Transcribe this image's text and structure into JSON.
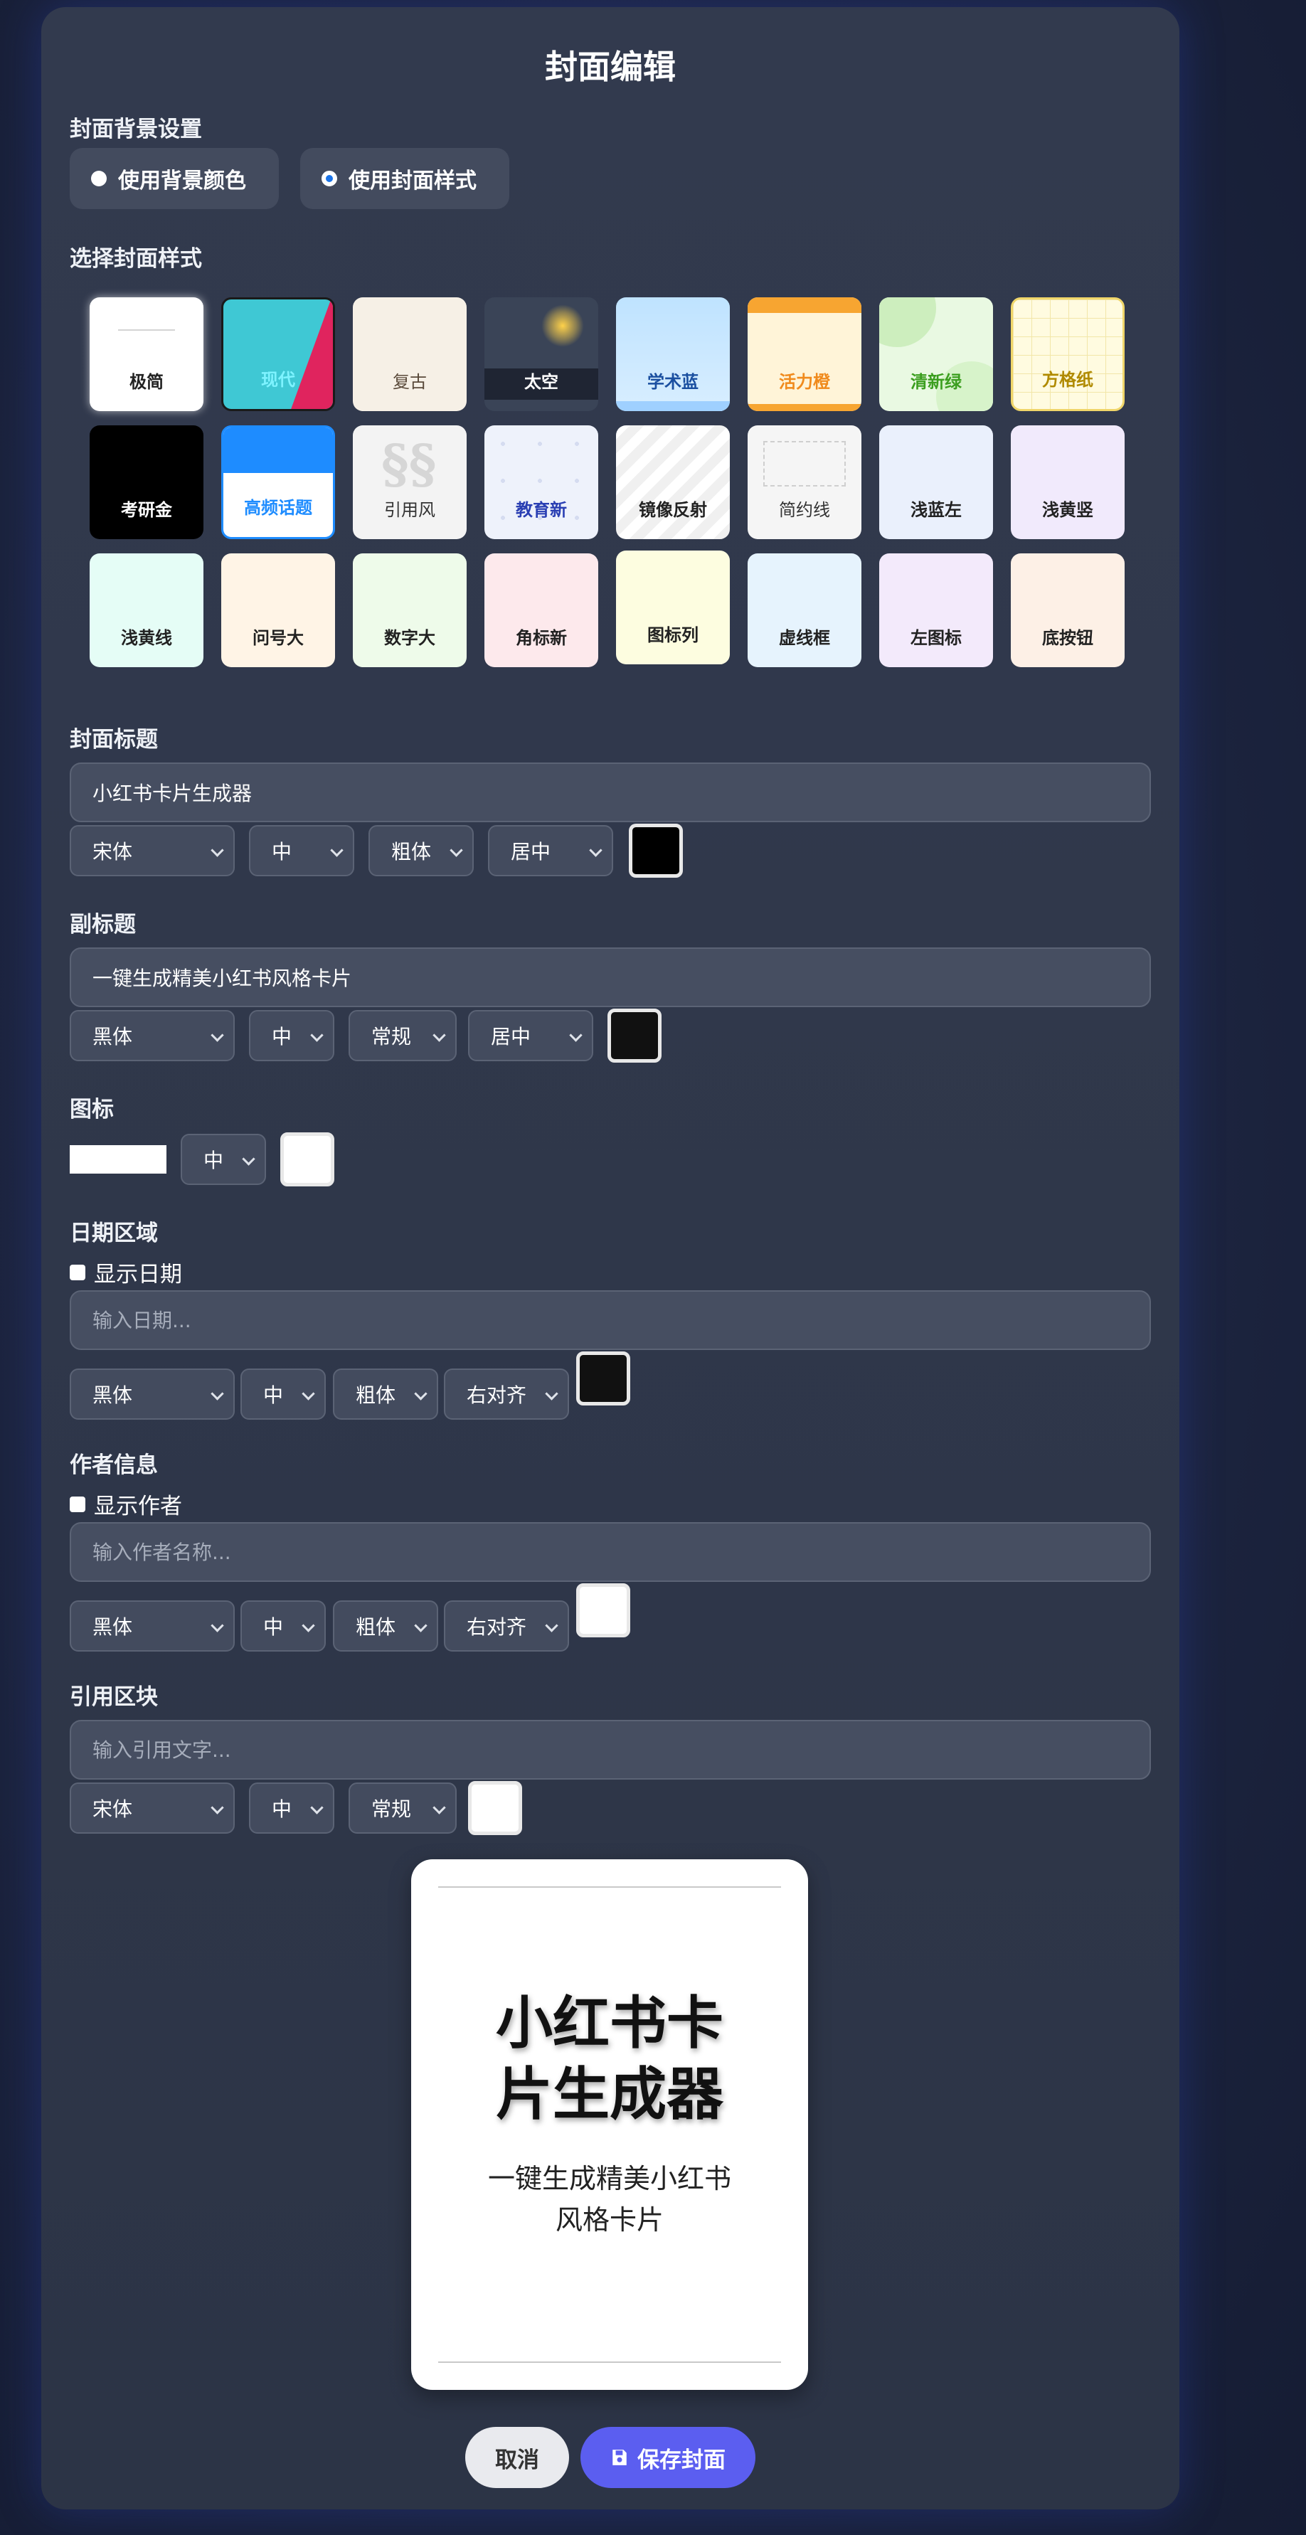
{
  "page": {
    "title": "封面编辑"
  },
  "background": {
    "label": "封面背景设置",
    "options": [
      {
        "label": "使用背景颜色",
        "selected": false
      },
      {
        "label": "使用封面样式",
        "selected": true
      }
    ]
  },
  "styles": {
    "label": "选择封面样式",
    "items": [
      "极简",
      "现代",
      "复古",
      "太空",
      "学术蓝",
      "活力橙",
      "清新绿",
      "方格纸",
      "考研金",
      "高频话题",
      "引用风",
      "教育新",
      "镜像反射",
      "简约线",
      "浅蓝左",
      "浅黄竖",
      "浅黄线",
      "问号大",
      "数字大",
      "角标新",
      "图标列",
      "虚线框",
      "左图标",
      "底按钮"
    ]
  },
  "cover_title": {
    "label": "封面标题",
    "value": "小红书卡片生成器",
    "font": "宋体",
    "size": "中",
    "weight": "粗体",
    "align": "居中",
    "color": "#000000"
  },
  "subtitle": {
    "label": "副标题",
    "value": "一键生成精美小红书风格卡片",
    "font": "黑体",
    "size": "中",
    "weight": "常规",
    "align": "居中",
    "color": "#111111"
  },
  "icon": {
    "label": "图标",
    "size": "中",
    "color": "#ffffff"
  },
  "date": {
    "label": "日期区域",
    "show_label": "显示日期",
    "placeholder": "输入日期...",
    "font": "黑体",
    "size": "中",
    "weight": "粗体",
    "align": "右对齐",
    "color": "#111111"
  },
  "author": {
    "label": "作者信息",
    "show_label": "显示作者",
    "placeholder": "输入作者名称...",
    "font": "黑体",
    "size": "中",
    "weight": "粗体",
    "align": "右对齐",
    "color": "#ffffff"
  },
  "quote": {
    "label": "引用区块",
    "placeholder": "输入引用文字...",
    "font": "宋体",
    "size": "中",
    "weight": "常规",
    "color": "#ffffff"
  },
  "preview": {
    "title": "小红书卡\n片生成器",
    "subtitle": "一键生成精美小红书\n风格卡片"
  },
  "actions": {
    "cancel": "取消",
    "save": "保存封面",
    "save_icon": "floppy-disk-icon"
  }
}
